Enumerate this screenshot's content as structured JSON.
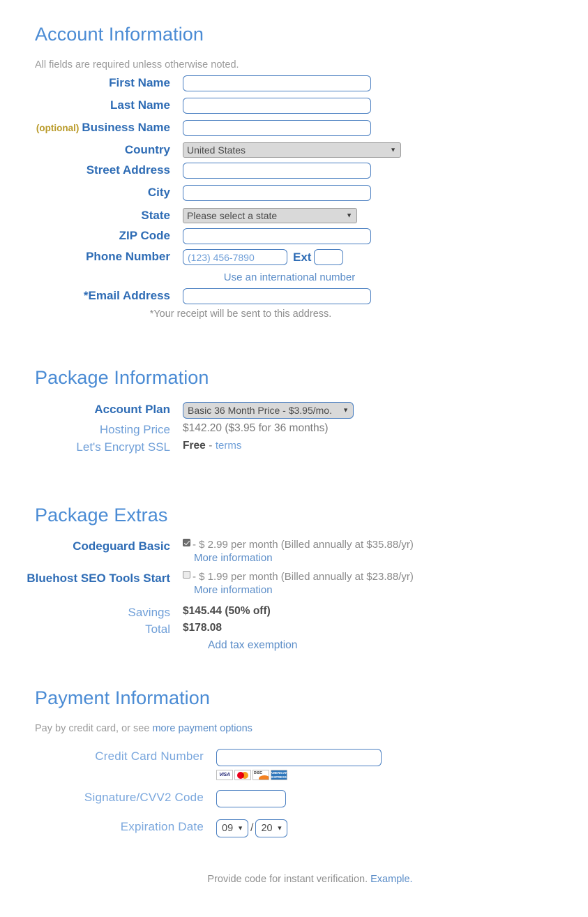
{
  "account": {
    "heading": "Account Information",
    "note": "All fields are required unless otherwise noted.",
    "fields": {
      "first_name_label": "First Name",
      "first_name_value": "",
      "last_name_label": "Last Name",
      "last_name_value": "",
      "business_optional": "(optional)",
      "business_name_label": "Business Name",
      "business_name_value": "",
      "country_label": "Country",
      "country_value": "United States",
      "street_label": "Street Address",
      "street_value": "",
      "city_label": "City",
      "city_value": "",
      "state_label": "State",
      "state_value": "Please select a state",
      "zip_label": "ZIP Code",
      "zip_value": "",
      "phone_label": "Phone Number",
      "phone_placeholder": "(123) 456-7890",
      "phone_value": "",
      "ext_label": "Ext",
      "ext_value": "",
      "international_link": "Use an international number",
      "email_label": "*Email Address",
      "email_value": "",
      "email_note": "*Your receipt will be sent to this address."
    }
  },
  "package": {
    "heading": "Package Information",
    "plan_label": "Account Plan",
    "plan_value": "Basic 36 Month Price - $3.95/mo.",
    "hosting_price_label": "Hosting Price",
    "hosting_price_value": "$142.20  ($3.95 for 36 months)",
    "ssl_label": "Let's Encrypt SSL",
    "ssl_value": "Free",
    "ssl_dash": "-",
    "ssl_terms_link": "terms"
  },
  "extras": {
    "heading": "Package Extras",
    "items": [
      {
        "label": "Codeguard Basic",
        "checked": true,
        "price_text": "- $ 2.99 per month (Billed annually at $35.88/yr)",
        "more_info": "More information"
      },
      {
        "label": "Bluehost SEO Tools Start",
        "checked": false,
        "price_text": "- $ 1.99 per month (Billed annually at $23.88/yr)",
        "more_info": "More information"
      }
    ],
    "savings_label": "Savings",
    "savings_value": "$145.44 (50% off)",
    "total_label": "Total",
    "total_value": "$178.08",
    "tax_exemption_link": "Add tax exemption"
  },
  "payment": {
    "heading": "Payment Information",
    "intro_prefix": "Pay by credit card, or see ",
    "intro_link": "more payment options",
    "cc_label": "Credit Card Number",
    "cc_value": "",
    "cards": [
      "VISA",
      "MasterCard",
      "Discover",
      "American Express"
    ],
    "cvv_label": "Signature/CVV2 Code",
    "cvv_value": "",
    "exp_label": "Expiration Date",
    "exp_month": "09",
    "exp_year": "20",
    "exp_separator": "/",
    "footer_text": "Provide code for instant verification. ",
    "footer_link": "Example."
  },
  "colors": {
    "heading_blue": "#4a8bd4",
    "label_blue": "#2e6cb5",
    "light_blue": "#6f9fd8",
    "optional_gold": "#b99a28",
    "muted_gray": "#8e8e8e"
  }
}
